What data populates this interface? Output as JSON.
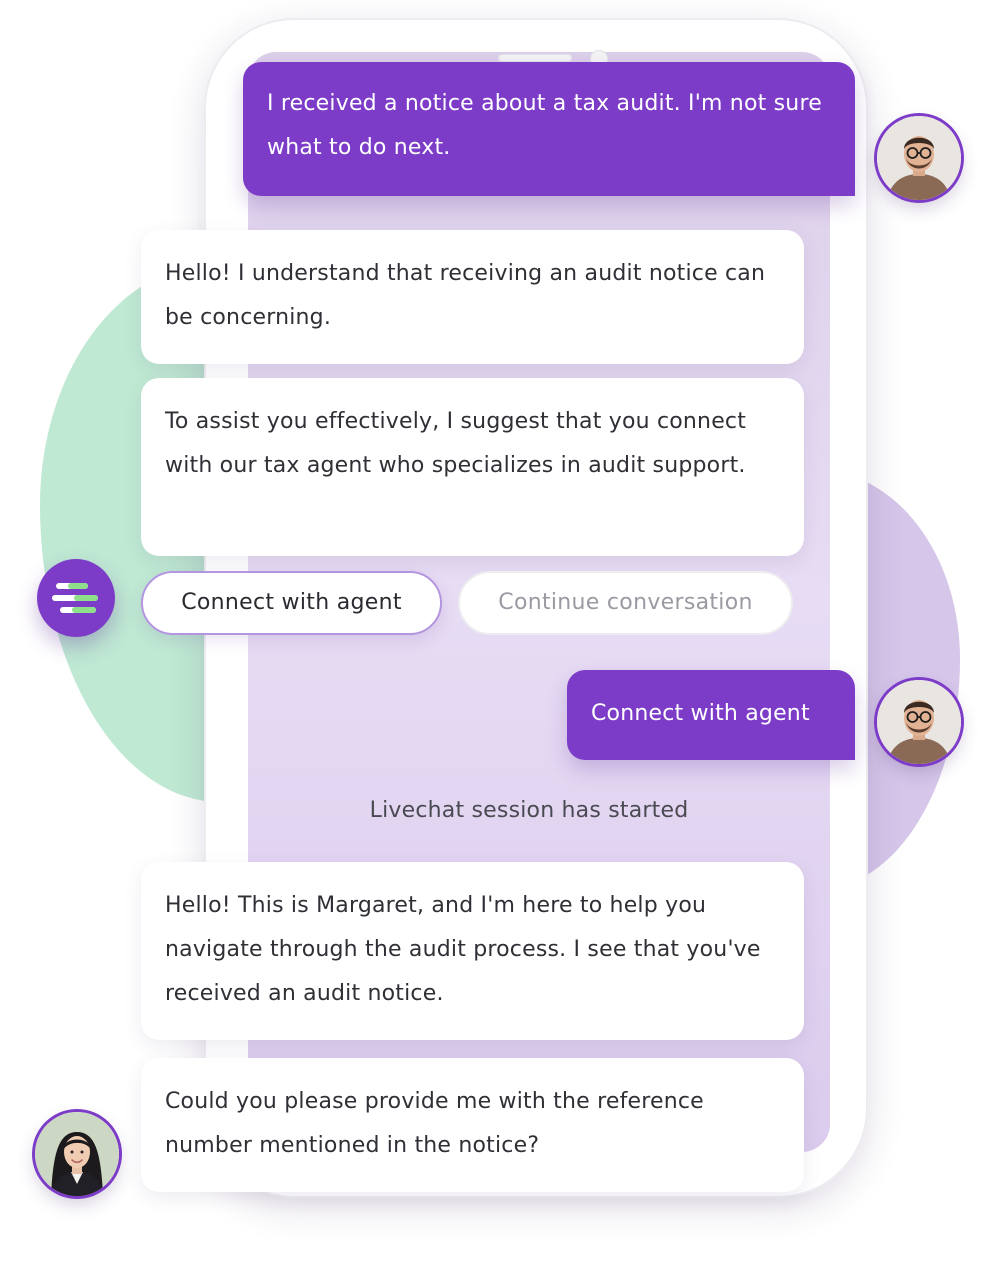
{
  "conversation": {
    "user_message_1": "I received a notice about a tax audit. I'm not sure what to do next.",
    "bot_message_1": "Hello! I understand that receiving an audit notice can be concerning.",
    "bot_message_2": "To assist you effectively, I suggest that you connect with our tax agent who specializes in audit support.",
    "quick_replies": {
      "primary": "Connect with agent",
      "secondary": "Continue conversation"
    },
    "user_message_2": "Connect with agent",
    "system_note": "Livechat session has started",
    "agent_message_1": "Hello! This is Margaret, and I'm here to help you navigate through the audit process. I see that you've received an audit notice.",
    "agent_message_2": "Could you please provide me with the reference number mentioned in the notice?"
  },
  "avatars": {
    "user": "man-with-glasses-avatar",
    "agent": "woman-agent-avatar",
    "bot": "chatbot-logo-icon"
  },
  "colors": {
    "accent": "#7d3cc8",
    "screen_background": "#e4d8f2",
    "green_blob": "#bfe9d3",
    "purple_blob": "#d6c6ea",
    "logo_lines": "#8fe08a"
  }
}
